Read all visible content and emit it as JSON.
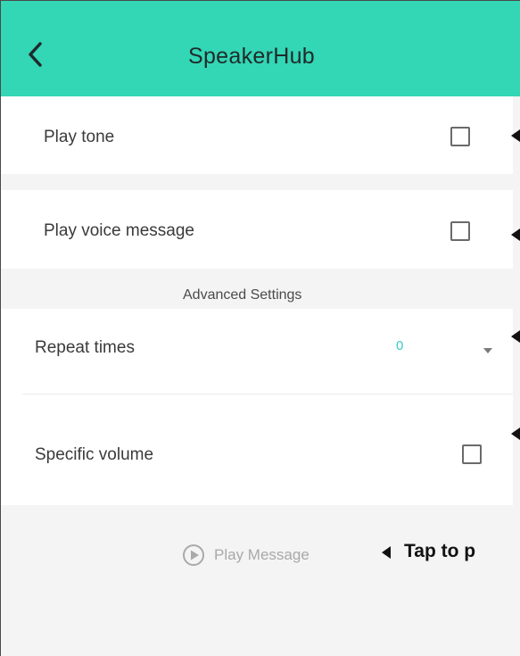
{
  "header": {
    "title": "SpeakerHub",
    "back_icon": "chevron-left-icon"
  },
  "settings": {
    "play_tone": {
      "label": "Play tone",
      "checked": false
    },
    "play_voice_message": {
      "label": "Play voice message",
      "checked": false
    },
    "advanced_heading": "Advanced Settings",
    "repeat_times": {
      "label": "Repeat times",
      "value": "0"
    },
    "specific_volume": {
      "label": "Specific volume",
      "checked": false
    }
  },
  "actions": {
    "play_message_label": "Play Message",
    "play_icon": "play-circle-icon"
  },
  "annotation": {
    "text": "Tap to p"
  },
  "colors": {
    "header_bg": "#33d6b5",
    "accent_value": "#38c9c4",
    "page_bg": "#f4f4f4"
  }
}
